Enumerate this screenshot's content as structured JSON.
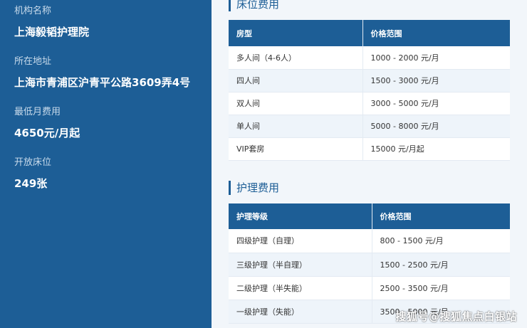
{
  "sidebar": {
    "items": [
      {
        "label": "机构名称",
        "value": "上海毅韬护理院"
      },
      {
        "label": "所在地址",
        "value": "上海市青浦区沪青平公路3609弄4号"
      },
      {
        "label": "最低月费用",
        "value": "4650元/月起"
      },
      {
        "label": "开放床位",
        "value": "249张"
      }
    ]
  },
  "bed_fees": {
    "title": "床位费用",
    "headers": [
      "房型",
      "价格范围"
    ],
    "rows": [
      [
        "多人间（4-6人）",
        "1000 - 2000 元/月"
      ],
      [
        "四人间",
        "1500 - 3000 元/月"
      ],
      [
        "双人间",
        "3000 - 5000 元/月"
      ],
      [
        "单人间",
        "5000 - 8000 元/月"
      ],
      [
        "VIP套房",
        "15000 元/月起"
      ]
    ]
  },
  "care_fees": {
    "title": "护理费用",
    "headers": [
      "护理等级",
      "价格范围"
    ],
    "rows": [
      [
        "四级护理（自理）",
        "800 - 1500 元/月"
      ],
      [
        "三级护理（半自理）",
        "1500 - 2500 元/月"
      ],
      [
        "二级护理（半失能）",
        "2500 - 3500 元/月"
      ],
      [
        "一级护理（失能）",
        "3500 - 5000 元/月"
      ]
    ]
  },
  "watermark": "搜狐号@搜狐焦点白银站"
}
